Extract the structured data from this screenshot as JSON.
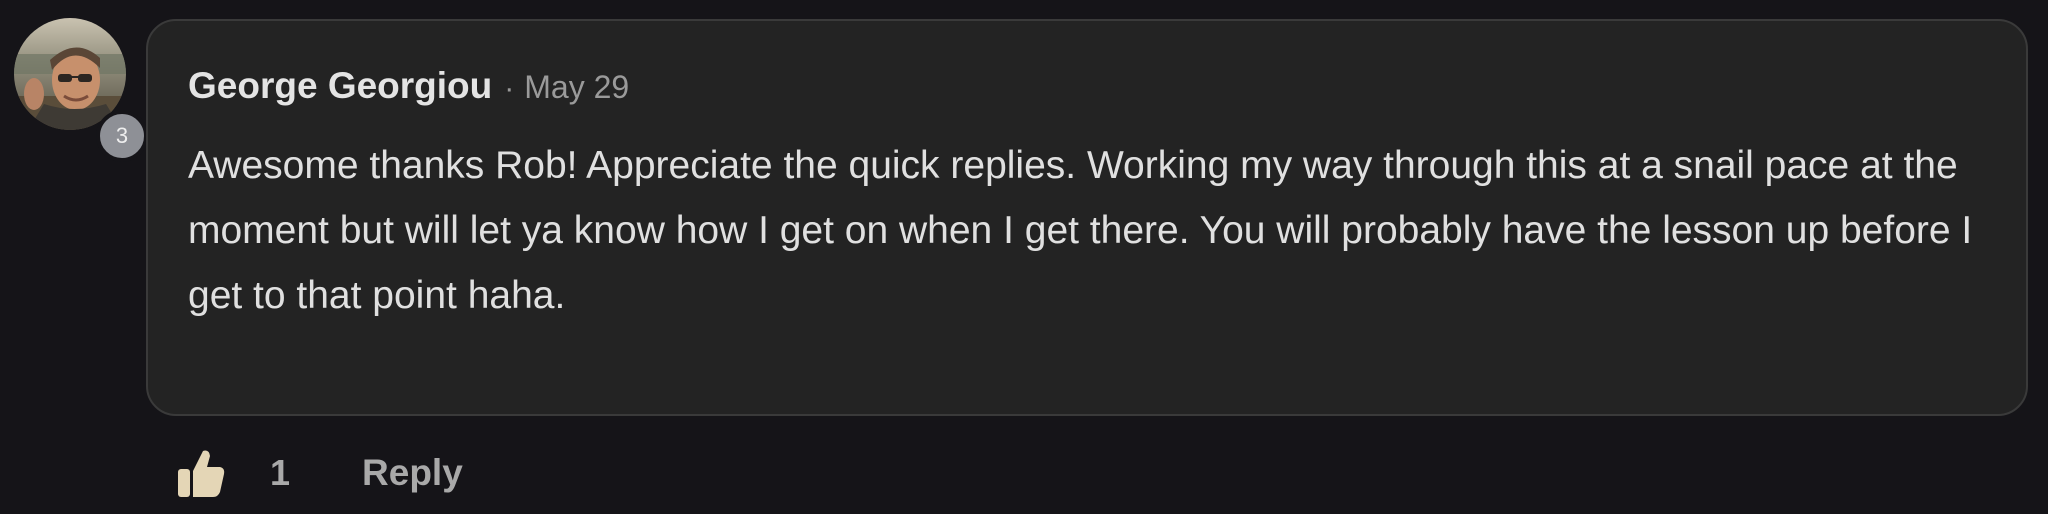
{
  "comment": {
    "author": "George Georgiou",
    "separator": "·",
    "date": "May 29",
    "level": "3",
    "text": "Awesome thanks Rob! Appreciate the quick replies. Working my way through this at a snail pace at the moment but will let ya know how I get on when I get there. You will probably have the lesson up before I get to that point haha.",
    "likes": "1",
    "reply_label": "Reply"
  },
  "colors": {
    "background": "#151418",
    "bubble": "#232323",
    "bubble_border": "#3a3a3a",
    "text": "#e0e0e0",
    "muted": "#9a9a9a",
    "badge": "#8e9096",
    "thumb": "#e4d6b6"
  },
  "icons": {
    "like": "thumbs-up-icon",
    "avatar": "user-avatar-photo"
  }
}
